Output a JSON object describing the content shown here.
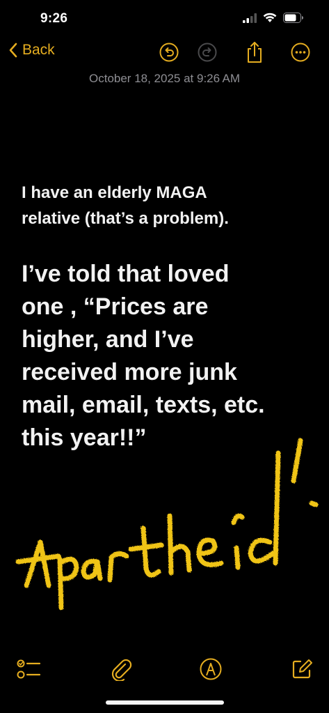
{
  "status_bar": {
    "time": "9:26",
    "icons": [
      "cellular-signal-icon",
      "wifi-icon",
      "battery-icon"
    ]
  },
  "nav": {
    "back_label": "Back",
    "icons": [
      "undo-icon",
      "redo-icon",
      "share-icon",
      "more-icon"
    ]
  },
  "note": {
    "date": "October 18, 2025 at 9:26 AM",
    "paragraph_small": [
      "I have an elderly MAGA",
      "relative (that’s a problem)."
    ],
    "paragraph_large": [
      "I’ve told that loved",
      "one , “Prices are",
      "higher, and I’ve",
      "received more junk",
      "mail, email, texts, etc.",
      "this year!!”"
    ],
    "handwriting": "Apartheid!"
  },
  "toolbar": {
    "icons": [
      "checklist-icon",
      "paperclip-icon",
      "markup-pen-icon",
      "compose-icon"
    ]
  },
  "colors": {
    "accent": "#e5ad20",
    "background": "#000000",
    "text": "#f2f2f2",
    "secondary": "#8e8e93",
    "handwriting": "#f0c419"
  }
}
